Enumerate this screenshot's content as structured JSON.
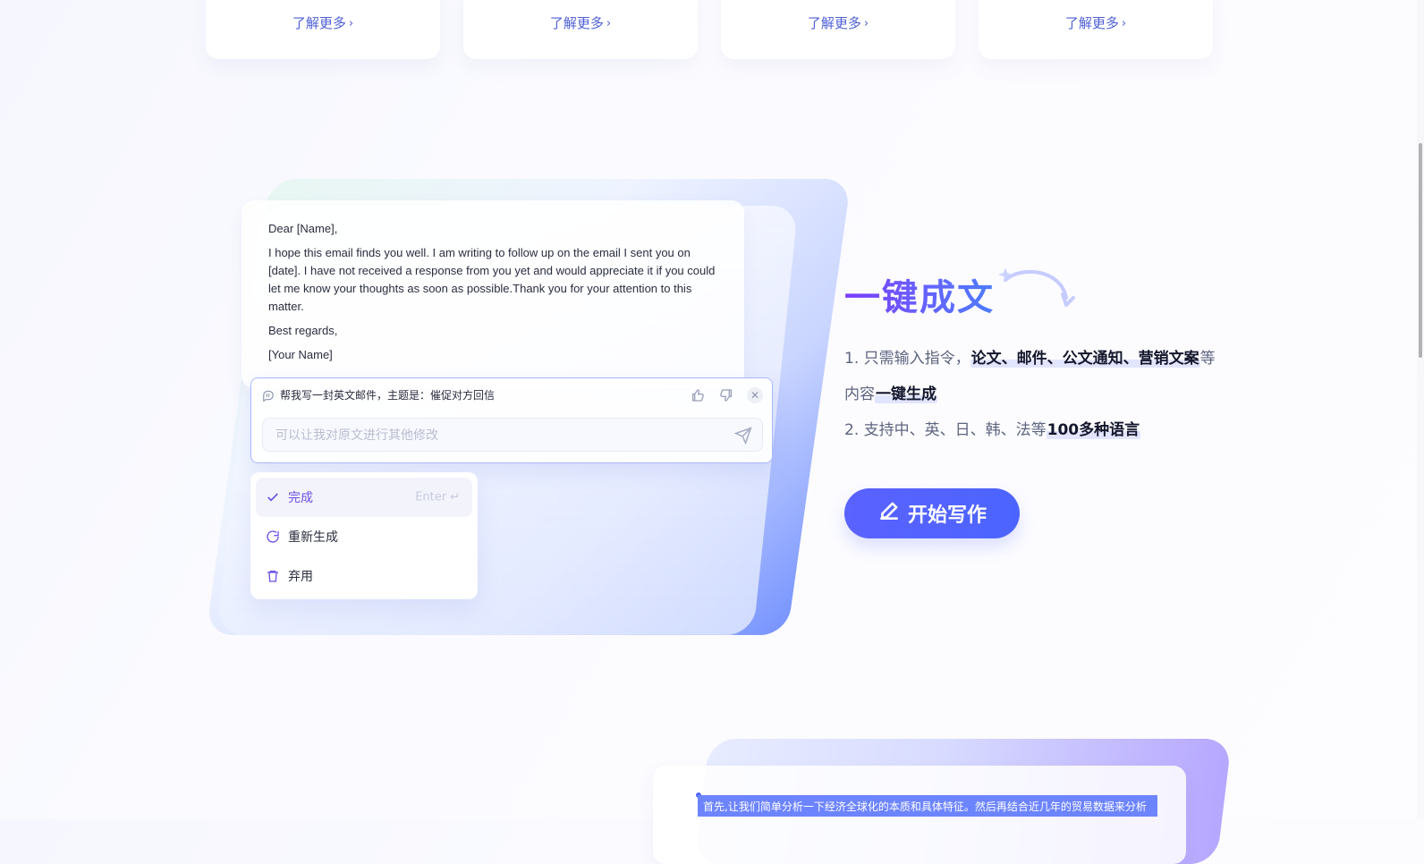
{
  "top_cards": [
    {
      "link_label": "了解更多"
    },
    {
      "link_label": "了解更多"
    },
    {
      "link_label": "了解更多"
    },
    {
      "link_label": "了解更多"
    }
  ],
  "email": {
    "greeting": "Dear [Name],",
    "body": "I hope this email finds you well. I am writing to follow up on the email I sent you on [date]. I have not received a response from you yet and would appreciate it if you could let me know your thoughts as soon as possible.Thank you for your attention to this matter.",
    "closing": "Best regards,",
    "signature": "[Your Name]"
  },
  "prompt": {
    "instruction": "帮我写一封英文邮件，主题是：催促对方回信",
    "placeholder": "可以让我对原文进行其他修改"
  },
  "menu": {
    "items": [
      {
        "label": "完成",
        "shortcut": "Enter"
      },
      {
        "label": "重新生成"
      },
      {
        "label": "弃用"
      }
    ]
  },
  "feature": {
    "title": "一键成文",
    "line1_prefix": "1. 只需输入指令，",
    "line1_highlight": "论文、邮件、公文通知、营销文案",
    "line1_suffix": "等",
    "line2_prefix": "内容",
    "line2_highlight": "一键生成",
    "line3_prefix": "2. 支持中、英、日、韩、法等",
    "line3_highlight": "100多种语言",
    "cta_label": "开始写作"
  },
  "bottom_preview": {
    "selected_text": "首先,让我们简单分析一下经济全球化的本质和具体特征。然后再结合近几年的贸易数据来分析"
  },
  "colors": {
    "accent": "#4c64ff",
    "accent_purple": "#7a3cff",
    "text_dark": "#14172c",
    "text_muted": "#5e647f"
  }
}
